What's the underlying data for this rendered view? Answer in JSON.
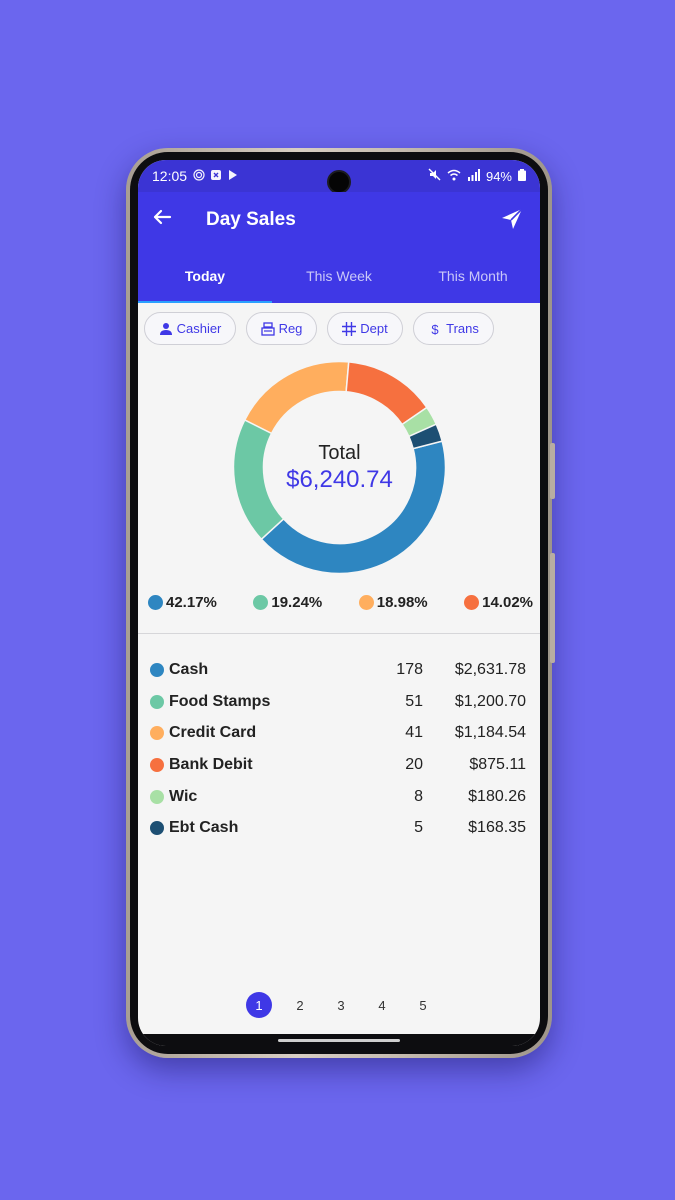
{
  "status_bar": {
    "time": "12:05",
    "left_icons": [
      "fingerprint-icon",
      "app-x-icon",
      "app-play-icon"
    ],
    "right_icons": [
      "mute-icon",
      "wifi-icon",
      "signal-icon"
    ],
    "battery": "94%"
  },
  "app_bar": {
    "title": "Day Sales",
    "back_icon": "arrow-left-icon",
    "action_icon": "send-icon"
  },
  "tabs": [
    {
      "label": "Today",
      "active": true
    },
    {
      "label": "This Week",
      "active": false
    },
    {
      "label": "This Month",
      "active": false
    }
  ],
  "filters": [
    {
      "label": "Cashier",
      "icon": "person-icon"
    },
    {
      "label": "Reg",
      "icon": "register-icon"
    },
    {
      "label": "Dept",
      "icon": "grid-icon"
    },
    {
      "label": "Trans",
      "icon": "dollar-icon"
    }
  ],
  "chart_data": {
    "type": "pie",
    "center_label": "Total",
    "center_value": "$6,240.74",
    "categories": [
      "Cash",
      "Food Stamps",
      "Credit Card",
      "Bank Debit",
      "Wic",
      "Ebt Cash"
    ],
    "values": [
      2631.78,
      1200.7,
      1184.54,
      875.11,
      180.26,
      168.35
    ],
    "colors": [
      "#2e86c1",
      "#6cc8a5",
      "#ffae5e",
      "#f6703f",
      "#a8e0a5",
      "#1d4f73"
    ],
    "donut": true
  },
  "legend": [
    {
      "label": "42.17%",
      "color": "#2e86c1"
    },
    {
      "label": "19.24%",
      "color": "#6cc8a5"
    },
    {
      "label": "18.98%",
      "color": "#ffae5e"
    },
    {
      "label": "14.02%",
      "color": "#f6703f"
    }
  ],
  "table": {
    "rows": [
      {
        "name": "Cash",
        "count": "178",
        "amount": "$2,631.78",
        "color": "#2e86c1"
      },
      {
        "name": "Food Stamps",
        "count": "51",
        "amount": "$1,200.70",
        "color": "#6cc8a5"
      },
      {
        "name": "Credit Card",
        "count": "41",
        "amount": "$1,184.54",
        "color": "#ffae5e"
      },
      {
        "name": "Bank Debit",
        "count": "20",
        "amount": "$875.11",
        "color": "#f6703f"
      },
      {
        "name": "Wic",
        "count": "8",
        "amount": "$180.26",
        "color": "#a8e0a5"
      },
      {
        "name": "Ebt Cash",
        "count": "5",
        "amount": "$168.35",
        "color": "#1d4f73"
      }
    ]
  },
  "pagination": {
    "pages": [
      "1",
      "2",
      "3",
      "4",
      "5"
    ],
    "current": "1"
  },
  "colors": {
    "background": "#6b66ee",
    "primary": "#3f38e6",
    "tab_indicator": "#2aa0ff"
  }
}
